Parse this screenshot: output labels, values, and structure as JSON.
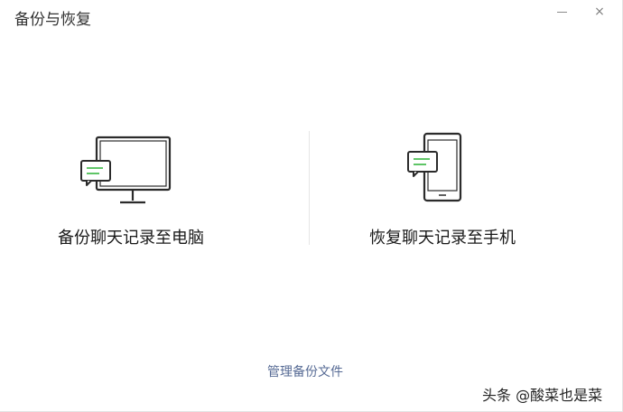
{
  "window": {
    "title": "备份与恢复",
    "minimize_icon": "minimize-icon",
    "close_icon": "close-icon",
    "close_glyph": "×"
  },
  "options": [
    {
      "label": "备份聊天记录至电脑",
      "icon": "monitor-chat-icon"
    },
    {
      "label": "恢复聊天记录至手机",
      "icon": "phone-chat-icon"
    }
  ],
  "footer": {
    "manage_link": "管理备份文件"
  },
  "watermark": {
    "text": "头条 @酸菜也是菜"
  },
  "colors": {
    "link": "#576b95",
    "accent_green": "#4cbf55",
    "text": "#191919"
  }
}
